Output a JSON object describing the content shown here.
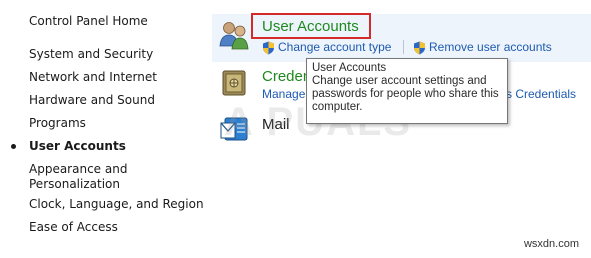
{
  "sidebar": {
    "items": [
      {
        "label": "Control Panel Home"
      },
      {
        "label": "System and Security"
      },
      {
        "label": "Network and Internet"
      },
      {
        "label": "Hardware and Sound"
      },
      {
        "label": "Programs"
      },
      {
        "label": "User Accounts",
        "active": true
      },
      {
        "label": "Appearance and"
      },
      {
        "label": "Personalization"
      },
      {
        "label": "Clock, Language, and Region"
      },
      {
        "label": "Ease of Access"
      }
    ]
  },
  "main": {
    "user_accounts": {
      "title": "User Accounts",
      "links": [
        "Change account type",
        "Remove user accounts"
      ]
    },
    "credential": {
      "title_partial": "Creden",
      "link_partial": "Manage",
      "link_tail": "s Credentials"
    },
    "mail": {
      "title": "Mail"
    }
  },
  "tooltip": {
    "title": "User Accounts",
    "lines": [
      "Change user account settings and",
      "passwords for people who share this",
      "computer."
    ]
  },
  "watermarks": {
    "appuals": "A PUALS",
    "site": "wsxdn.com"
  },
  "colors": {
    "link": "#1e5bb0",
    "category_title": "#1e8a1e",
    "highlight_bg": "#eef4fc",
    "red_box": "#d42a2a"
  },
  "icons": {
    "user_accounts": "users-icon",
    "credential": "vault-icon",
    "mail": "mail-icon",
    "shield": "uac-shield-icon"
  }
}
